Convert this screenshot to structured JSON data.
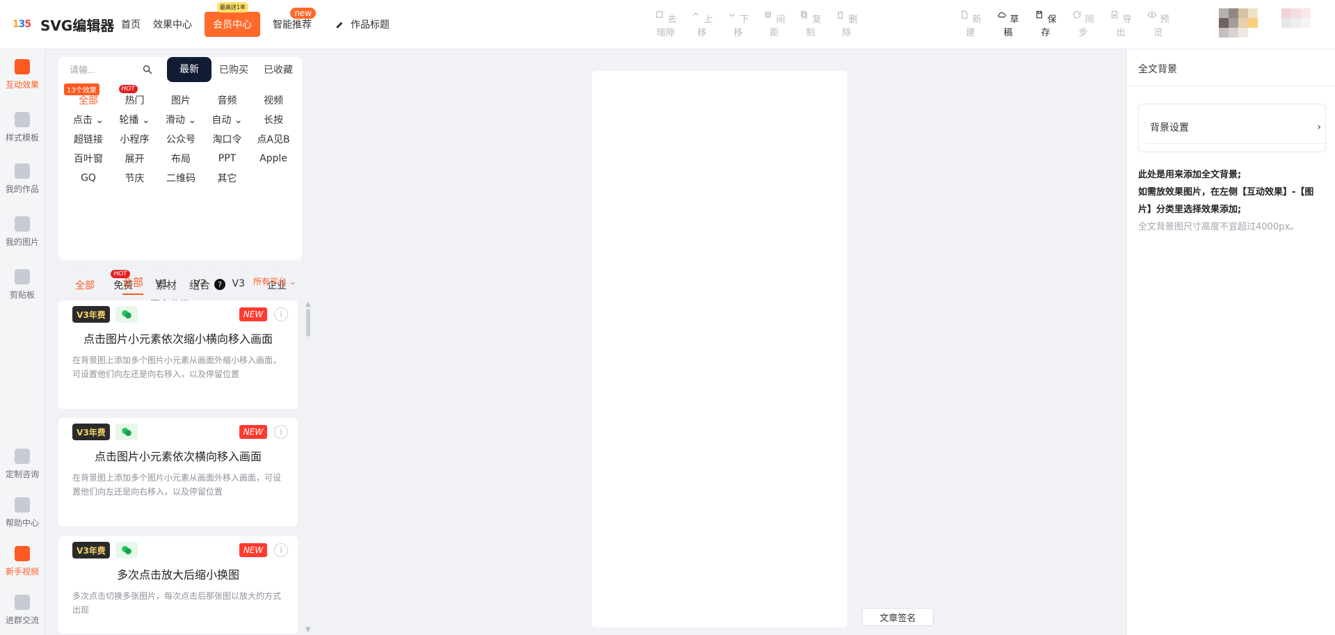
{
  "header": {
    "logo_text": "SVG编辑器",
    "nav": {
      "home": "首页",
      "effects_center": "效果中心",
      "member_center": "会员中心",
      "member_badge": "最高送1年",
      "smart_recommend": "智能推荐",
      "smart_new": "new",
      "work_title": "作品标题"
    },
    "toolbar_center": [
      {
        "label": "去暗隙",
        "icon": "square-icon"
      },
      {
        "label": "上移",
        "icon": "chevron-up-icon"
      },
      {
        "label": "下移",
        "icon": "chevron-down-icon"
      },
      {
        "label": "间距",
        "icon": "grid-icon"
      },
      {
        "label": "复制",
        "icon": "copy-icon"
      },
      {
        "label": "删除",
        "icon": "trash-icon"
      }
    ],
    "toolbar_right": [
      {
        "label": "新建",
        "icon": "file-icon"
      },
      {
        "label": "草稿",
        "icon": "cloud-icon"
      },
      {
        "label": "保存",
        "icon": "save-icon"
      },
      {
        "label": "同步",
        "icon": "refresh-icon"
      },
      {
        "label": "导出",
        "icon": "export-icon"
      },
      {
        "label": "预览",
        "icon": "eye-icon"
      }
    ]
  },
  "sidebar": {
    "items": [
      {
        "label": "互动效果",
        "icon": "cube-icon",
        "active": true
      },
      {
        "label": "样式模板",
        "icon": "template-icon"
      },
      {
        "label": "我的作品",
        "icon": "folder-icon"
      },
      {
        "label": "我的图片",
        "icon": "cloud-image-icon"
      },
      {
        "label": "剪贴板",
        "icon": "clipboard-icon"
      },
      {
        "label": "定制咨询",
        "icon": "headset-icon"
      },
      {
        "label": "帮助中心",
        "icon": "help-icon"
      },
      {
        "label": "新手视频",
        "icon": "video-icon",
        "active": true
      },
      {
        "label": "进群交流",
        "icon": "group-icon"
      }
    ]
  },
  "panel": {
    "search_placeholder": "请输...",
    "seg": [
      "最新",
      "已购买",
      "已收藏"
    ],
    "cat_rows": [
      [
        "全部",
        "热门",
        "图片",
        "音频",
        "视频"
      ],
      [
        "点击",
        "轮播",
        "滑动",
        "自动",
        "长按"
      ],
      [
        "超链接",
        "小程序",
        "公众号",
        "淘口令",
        "点A见B"
      ],
      [
        "百叶窗",
        "展开",
        "布局",
        "PPT",
        "Apple"
      ],
      [
        "GQ",
        "节庆",
        "二维码",
        "其它",
        ""
      ]
    ],
    "cat_hot": "HOT",
    "cat_count_badge": "13个效果",
    "versions": [
      "全部",
      "免费",
      "V1",
      "V2",
      "V3",
      "企业"
    ],
    "version_hot": "HOT",
    "more_label": "更多分类",
    "filter_tabs": [
      "全部",
      "素材",
      "组合"
    ],
    "platform_label": "所有平台"
  },
  "cards": [
    {
      "title": "点击图片小元素依次缩小横向移入画面",
      "desc": "在背景图上添加多个图片小元素从画面外缩小移入画面，可设置他们向左还是向右移入，以及停留位置",
      "v3": "V3年费",
      "new_label": "NEW"
    },
    {
      "title": "点击图片小元素依次横向移入画面",
      "desc": "在背景图上添加多个图片小元素从画面外移入画面，可设置他们向左还是向右移入，以及停留位置",
      "v3": "V3年费",
      "new_label": "NEW"
    },
    {
      "title": "多次点击放大后缩小换图",
      "desc": "多次点击切换多张图片，每次点击后那张图以放大的方式出现",
      "v3": "V3年费",
      "new_label": "NEW"
    }
  ],
  "canvas": {
    "signature_label": "文章签名"
  },
  "right": {
    "title": "全文背景",
    "bg_setting_label": "背景设置",
    "help": {
      "line1": "此处是用来添加全文背景;",
      "line2": "如需放效果图片，在左侧【互动效果】-【图片】分类里选择效果添加;",
      "line3": "全文背景图尺寸高度不宜超过4000px。"
    }
  }
}
